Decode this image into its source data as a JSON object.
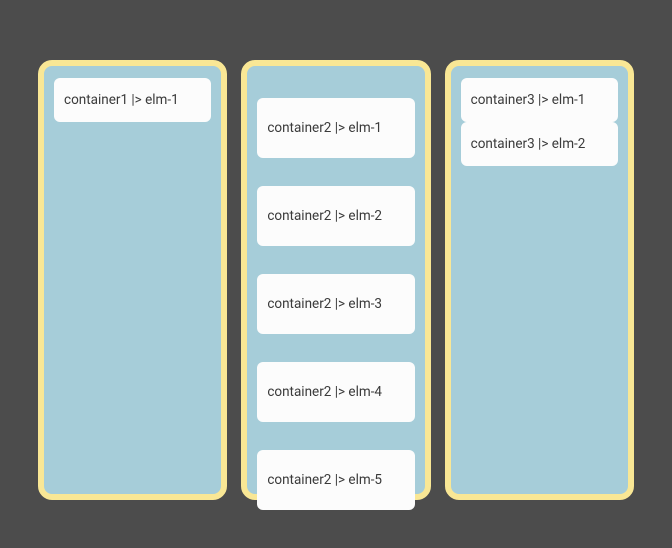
{
  "containers": [
    {
      "id": "container1",
      "items": [
        {
          "label": "container1 |> elm-1"
        }
      ]
    },
    {
      "id": "container2",
      "items": [
        {
          "label": "container2 |> elm-1"
        },
        {
          "label": "container2 |> elm-2"
        },
        {
          "label": "container2 |> elm-3"
        },
        {
          "label": "container2 |> elm-4"
        },
        {
          "label": "container2 |> elm-5"
        }
      ]
    },
    {
      "id": "container3",
      "items": [
        {
          "label": "container3 |> elm-1"
        },
        {
          "label": "container3 |> elm-2"
        }
      ]
    }
  ]
}
